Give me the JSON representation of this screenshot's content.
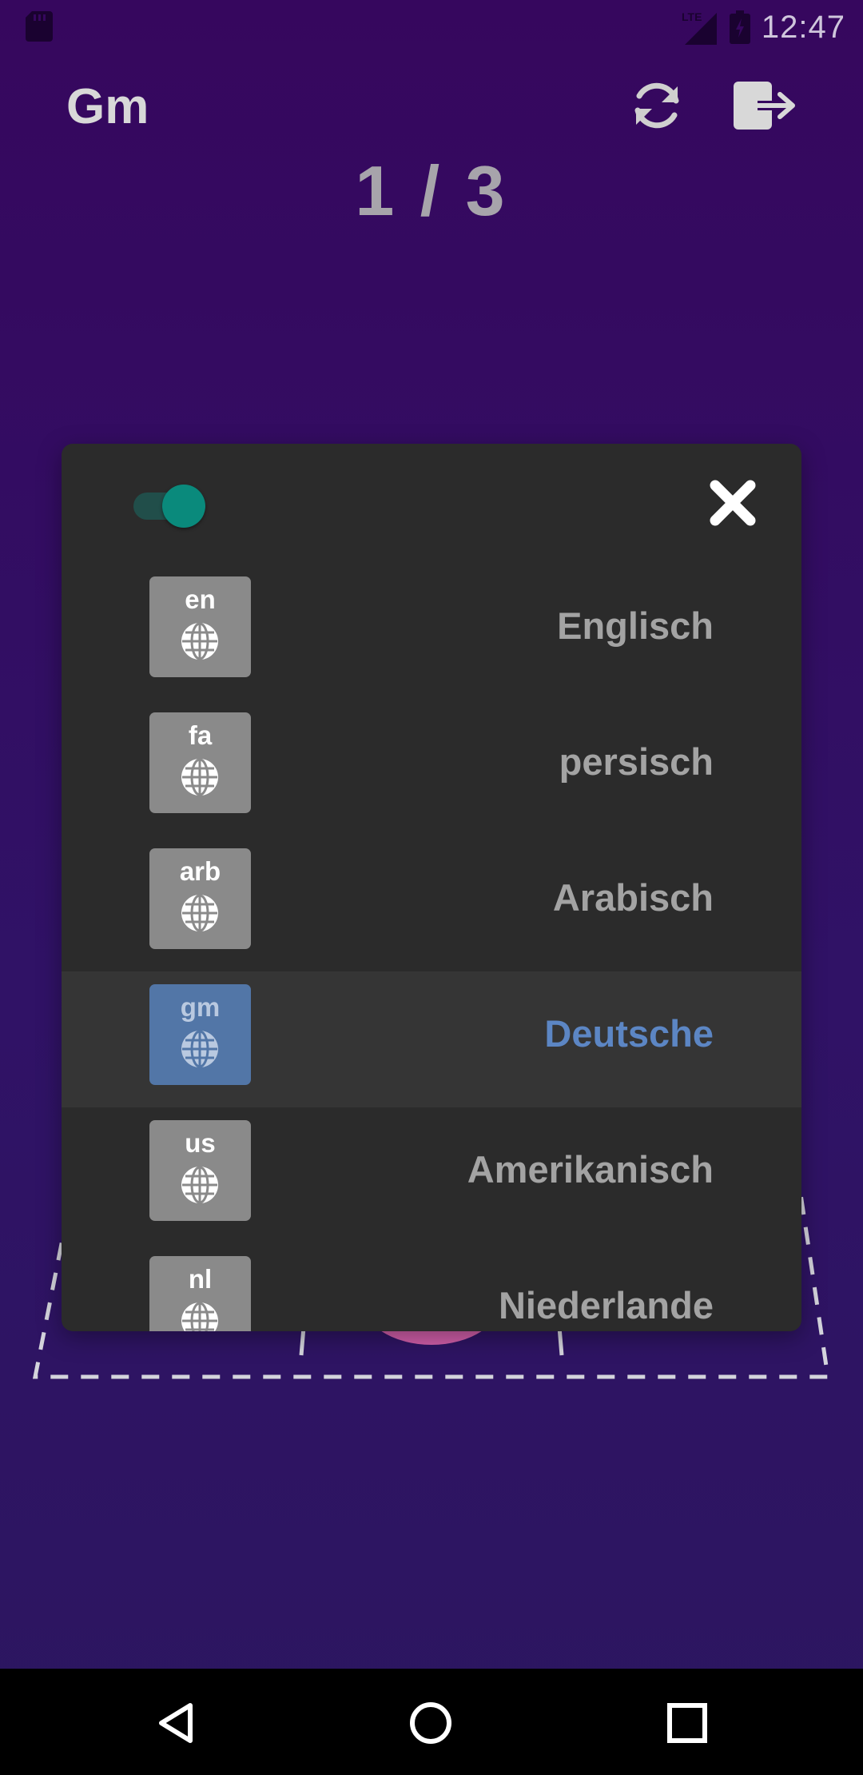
{
  "status_bar": {
    "time": "12:47",
    "network": "LTE",
    "icons": [
      "sd-card-icon",
      "signal-icon",
      "battery-icon"
    ]
  },
  "app_bar": {
    "title": "Gm",
    "actions": [
      "refresh-icon",
      "logout-icon"
    ]
  },
  "counter": "1 / 3",
  "dialog": {
    "toggle_on": true,
    "close_icon": "close-icon",
    "languages": [
      {
        "code": "en",
        "name": "Englisch",
        "selected": false
      },
      {
        "code": "fa",
        "name": "persisch",
        "selected": false
      },
      {
        "code": "arb",
        "name": "Arabisch",
        "selected": false
      },
      {
        "code": "gm",
        "name": "Deutsche",
        "selected": true
      },
      {
        "code": "us",
        "name": "Amerikanisch",
        "selected": false
      },
      {
        "code": "nl",
        "name": "Niederlande",
        "selected": false
      }
    ]
  },
  "colors": {
    "background": "#36075e",
    "dialog": "#2b2b2b",
    "accent_teal": "#0a8a7c",
    "selected_blue": "#5276a7",
    "selected_text": "#5c86c4",
    "badge_gray": "#8a8a8a"
  },
  "nav_bar": [
    "back-icon",
    "home-icon",
    "recents-icon"
  ]
}
